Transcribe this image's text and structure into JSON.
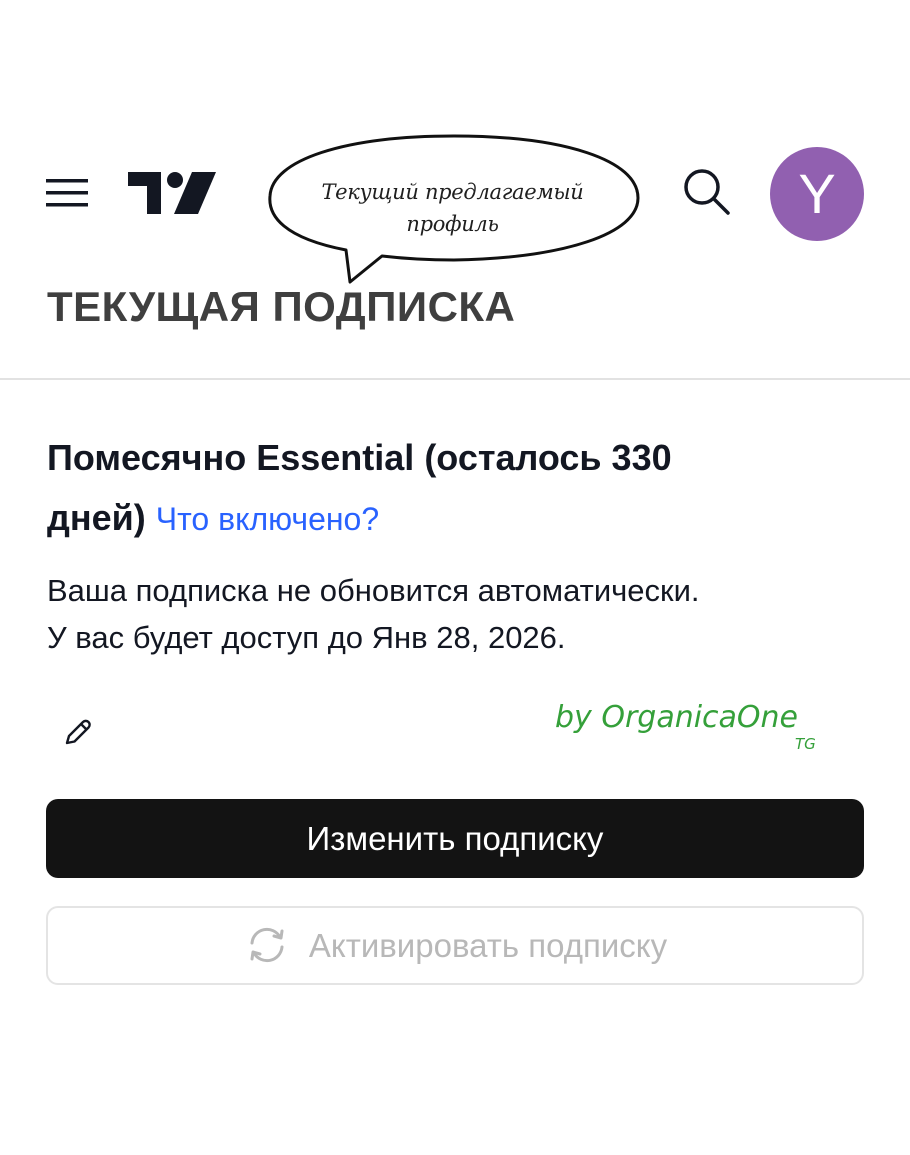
{
  "header": {
    "callout_line1": "Текущий предлагаемый",
    "callout_line2": "профиль",
    "avatar_letter": "Y",
    "icons": [
      "menu-icon",
      "tradingview-logo",
      "search-icon"
    ]
  },
  "section": {
    "title": "ТЕКУЩАЯ ПОДПИСКА"
  },
  "subscription": {
    "plan_line1": "Помесячно Essential (осталось 330",
    "plan_line2": "дней)",
    "whats_included_link": "Что включено?",
    "description_line1": "Ваша подписка не обновится автоматически.",
    "description_line2": "У вас будет доступ до Янв 28, 2026.",
    "edit_icon": "pencil-icon"
  },
  "watermark": {
    "text": "by OrganicaOne",
    "suffix": "TG"
  },
  "actions": {
    "change_label": "Изменить подписку",
    "activate_label": "Активировать подписку",
    "activate_icon": "refresh-icon"
  },
  "colors": {
    "avatar": "#9160b0",
    "link": "#2962ff",
    "primary_button": "#131313",
    "watermark": "#35a03a"
  }
}
